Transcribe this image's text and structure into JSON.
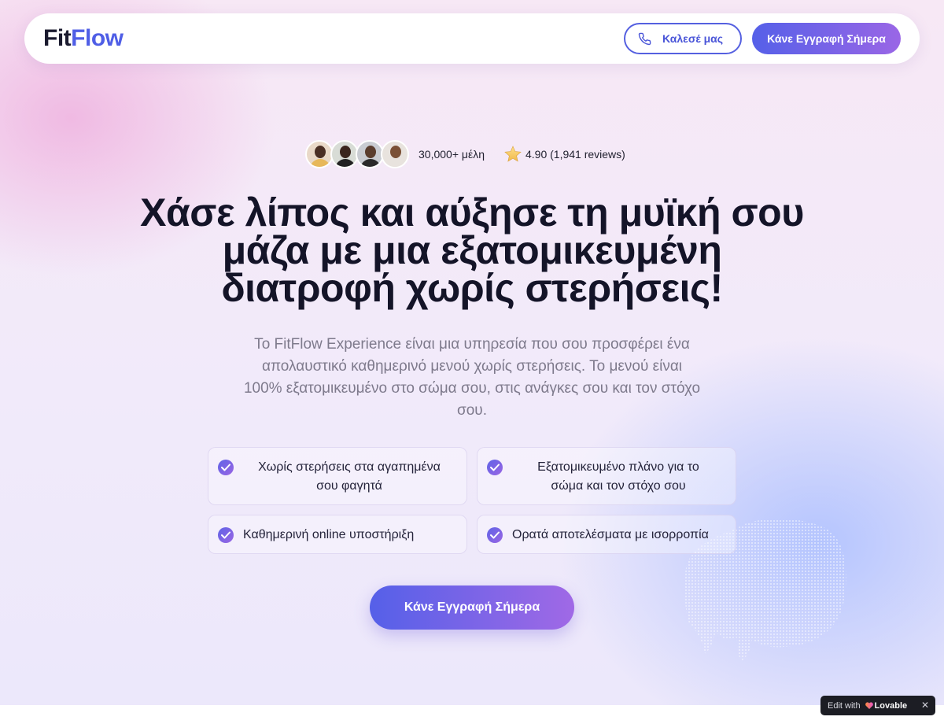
{
  "header": {
    "logo_part1": "Fit",
    "logo_part2": "Flow",
    "call_label": "Καλεσέ μας",
    "signup_label": "Κάνε Εγγραφή Σήμερα"
  },
  "social_proof": {
    "members": "30,000+ μέλη",
    "rating": "4.90 (1,941 reviews)"
  },
  "hero": {
    "headline_line1": "Χάσε λίπος και αύξησε τη μυϊκή σου",
    "headline_line2": "μάζα με μια εξατομικευμένη",
    "headline_line3": "διατροφή χωρίς στερήσεις!",
    "subtext_line1": "Το FitFlow Experience είναι μια υπηρεσία που σου προσφέρει ένα",
    "subtext_line2": "απολαυστικό καθημερινό μενού χωρίς στερήσεις. Το μενού είναι",
    "subtext_line3": "100% εξατομικευμένο στο σώμα σου, στις ανάγκες σου και τον στόχο",
    "subtext_line4": "σου."
  },
  "features": [
    {
      "line1": "Χωρίς στερήσεις στα αγαπημένα",
      "line2": "σου φαγητά"
    },
    {
      "line1": "Εξατομικευμένο πλάνο για το",
      "line2": "σώμα και τον στόχο σου"
    },
    {
      "line1": "Καθημερινή online υποστήριξη"
    },
    {
      "line1": "Ορατά αποτελέσματα με ισορροπία"
    }
  ],
  "cta": {
    "label": "Κάνε Εγγραφή Σήμερα"
  },
  "badge": {
    "prefix": "Edit with",
    "brand": "Lovable"
  },
  "colors": {
    "accent": "#5560e8",
    "accent2": "#9a66e6",
    "heading": "#141428",
    "body_text": "#7e7a8c"
  },
  "icons": {
    "phone": "phone-icon",
    "star": "star-icon",
    "check": "check-icon",
    "close": "close-icon"
  }
}
